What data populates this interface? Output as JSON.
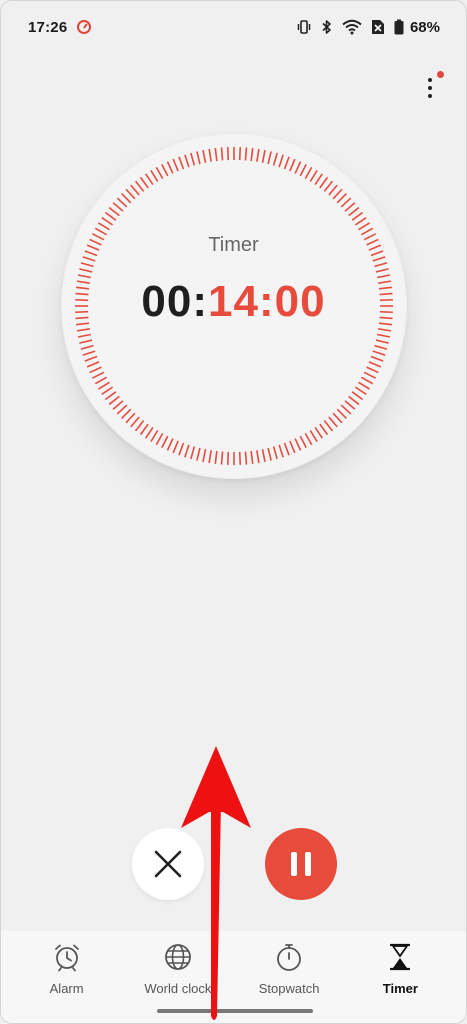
{
  "status_bar": {
    "time": "17:26",
    "battery": "68%",
    "icons": [
      "timer-icon",
      "vibrate-icon",
      "bluetooth-icon",
      "wifi-icon",
      "no-sim-icon",
      "battery-icon"
    ]
  },
  "timer": {
    "label": "Timer",
    "hours": "00",
    "separator": ":",
    "minutes_seconds": "14:00"
  },
  "controls": {
    "cancel": "close-icon",
    "pause": "pause-icon"
  },
  "nav": {
    "items": [
      {
        "label": "Alarm",
        "icon": "alarm-clock-icon"
      },
      {
        "label": "World clock",
        "icon": "globe-icon"
      },
      {
        "label": "Stopwatch",
        "icon": "stopwatch-icon"
      },
      {
        "label": "Timer",
        "icon": "hourglass-icon",
        "active": true
      }
    ]
  },
  "colors": {
    "accent": "#e64b3c",
    "background": "#f0f0f1",
    "annotation": "#ee1111"
  }
}
